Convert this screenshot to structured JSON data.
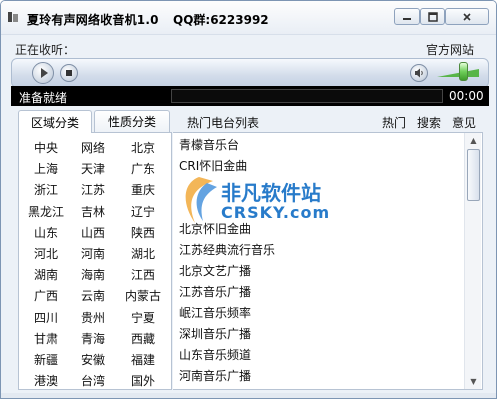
{
  "window": {
    "title": "夏玲有声网络收音机1.0",
    "qq": "QQ群:6223992"
  },
  "nowplaying": {
    "label": "正在收听：",
    "site_link": "官方网站"
  },
  "status": {
    "text": "准备就绪",
    "time": "00:00",
    "volume_level": 0.85
  },
  "tabs": [
    {
      "label": "区域分类",
      "active": true
    },
    {
      "label": "性质分类",
      "active": false
    }
  ],
  "right_header": {
    "title": "热门电台列表",
    "hot": "热门",
    "search": "搜索",
    "feedback": "意见"
  },
  "regions": [
    [
      "中央",
      "网络",
      "北京"
    ],
    [
      "上海",
      "天津",
      "广东"
    ],
    [
      "浙江",
      "江苏",
      "重庆"
    ],
    [
      "黑龙江",
      "吉林",
      "辽宁"
    ],
    [
      "山东",
      "山西",
      "陕西"
    ],
    [
      "河北",
      "河南",
      "湖北"
    ],
    [
      "湖南",
      "海南",
      "江西"
    ],
    [
      "广西",
      "云南",
      "内蒙古"
    ],
    [
      "四川",
      "贵州",
      "宁夏"
    ],
    [
      "甘肃",
      "青海",
      "西藏"
    ],
    [
      "新疆",
      "安徽",
      "福建"
    ],
    [
      "港澳",
      "台湾",
      "国外"
    ]
  ],
  "stations": [
    "青檬音乐台",
    "CRI怀旧金曲",
    "",
    "",
    "北京怀旧金曲",
    "江苏经典流行音乐",
    "北京文艺广播",
    "江苏音乐广播",
    "岷江音乐频率",
    "深圳音乐广播",
    "山东音乐频道",
    "河南音乐广播"
  ],
  "watermark": {
    "line1": "非凡软件站",
    "line2": "CRSKY.com"
  },
  "colors": {
    "accent": "#1670c6",
    "status_bg": "#000000",
    "window_bg": "#ecf1f7"
  }
}
